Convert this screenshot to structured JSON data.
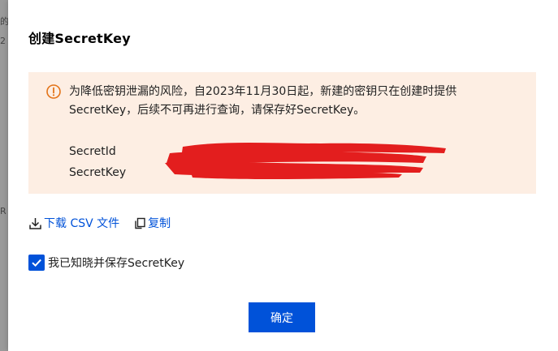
{
  "dialog": {
    "title": "创建SecretKey"
  },
  "notice": {
    "line1": "为降低密钥泄漏的风险，自2023年11月30日起，新建的密钥只在创建时提供",
    "line2": "SecretKey，后续不可再进行查询，请保存好SecretKey。",
    "icon": "warning-circle-icon",
    "background_color": "#fdeee3",
    "icon_color": "#e37318"
  },
  "credentials": {
    "secret_id_label": "SecretId",
    "secret_key_label": "SecretKey",
    "values_state": "redacted"
  },
  "actions": {
    "download_label": "下载 CSV 文件",
    "copy_label": "复制"
  },
  "acknowledge": {
    "label": "我已知晓并保存SecretKey",
    "checked": true
  },
  "footer": {
    "confirm_label": "确定"
  },
  "colors": {
    "primary": "#0052d9",
    "redaction": "#e31e1e"
  }
}
